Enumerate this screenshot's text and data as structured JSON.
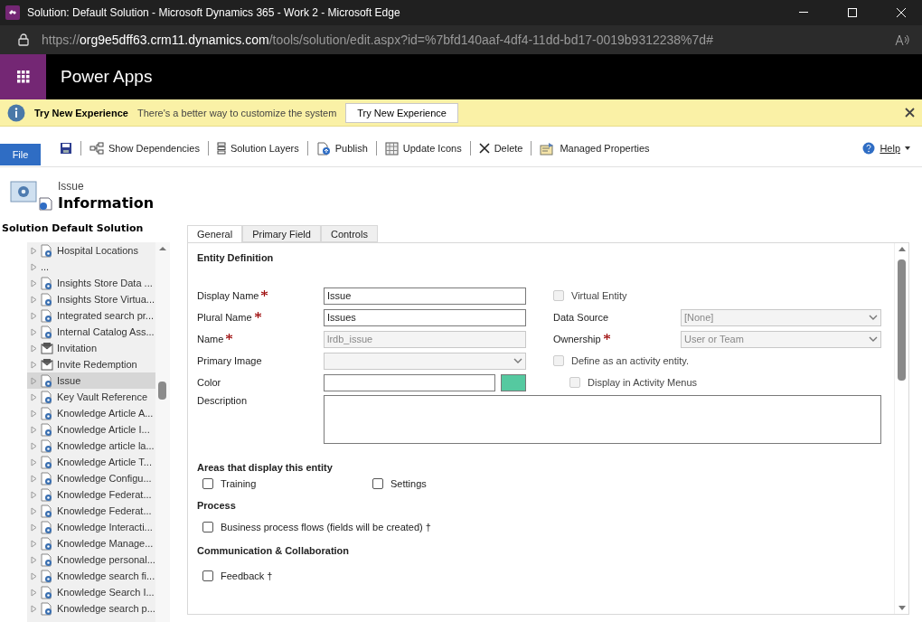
{
  "window": {
    "title": "Solution: Default Solution - Microsoft Dynamics 365 - Work 2 - Microsoft Edge",
    "url": {
      "scheme": "https://",
      "host": "org9e5dff63.crm11.dynamics.com",
      "path": "/tools/solution/edit.aspx?id=%7bfd140aaf-4df4-11dd-bd17-0019b9312238%7d#"
    }
  },
  "app_header": {
    "title": "Power Apps"
  },
  "notification": {
    "title": "Try New Experience",
    "message": "There's a better way to customize the system",
    "button": "Try New Experience"
  },
  "toolbar": {
    "file": "File",
    "items": [
      {
        "kind": "save"
      },
      {
        "kind": "deps",
        "label": "Show Dependencies"
      },
      {
        "kind": "layers",
        "label": "Solution Layers"
      },
      {
        "kind": "publish",
        "label": "Publish"
      },
      {
        "kind": "icons",
        "label": "Update Icons"
      },
      {
        "kind": "delete",
        "label": "Delete"
      },
      {
        "kind": "props",
        "label": "Managed Properties"
      }
    ],
    "help": "Help"
  },
  "entity_header": {
    "entity": "Issue",
    "section": "Information"
  },
  "sidebar": {
    "title": "Solution Default Solution",
    "items": [
      {
        "label": "Hospital Locations",
        "kind": "entity",
        "selected": false
      },
      {
        "label": "...",
        "kind": "blank",
        "selected": false
      },
      {
        "label": "Insights Store Data ...",
        "kind": "entity",
        "selected": false
      },
      {
        "label": "Insights Store Virtua...",
        "kind": "entity",
        "selected": false
      },
      {
        "label": "Integrated search pr...",
        "kind": "entity",
        "selected": false
      },
      {
        "label": "Internal Catalog Ass...",
        "kind": "entity",
        "selected": false
      },
      {
        "label": "Invitation",
        "kind": "mail",
        "selected": false
      },
      {
        "label": "Invite Redemption",
        "kind": "mail",
        "selected": false
      },
      {
        "label": "Issue",
        "kind": "entity",
        "selected": true
      },
      {
        "label": "Key Vault Reference",
        "kind": "entity",
        "selected": false
      },
      {
        "label": "Knowledge Article A...",
        "kind": "entity",
        "selected": false
      },
      {
        "label": "Knowledge Article I...",
        "kind": "entity",
        "selected": false
      },
      {
        "label": "Knowledge article la...",
        "kind": "entity",
        "selected": false
      },
      {
        "label": "Knowledge Article T...",
        "kind": "entity",
        "selected": false
      },
      {
        "label": "Knowledge Configu...",
        "kind": "entity",
        "selected": false
      },
      {
        "label": "Knowledge Federat...",
        "kind": "entity",
        "selected": false
      },
      {
        "label": "Knowledge Federat...",
        "kind": "entity",
        "selected": false
      },
      {
        "label": "Knowledge Interacti...",
        "kind": "entity",
        "selected": false
      },
      {
        "label": "Knowledge Manage...",
        "kind": "entity",
        "selected": false
      },
      {
        "label": "Knowledge personal...",
        "kind": "entity",
        "selected": false
      },
      {
        "label": "Knowledge search fi...",
        "kind": "entity",
        "selected": false
      },
      {
        "label": "Knowledge Search I...",
        "kind": "entity",
        "selected": false
      },
      {
        "label": "Knowledge search p...",
        "kind": "entity",
        "selected": false
      }
    ]
  },
  "tabs": [
    {
      "label": "General",
      "selected": true
    },
    {
      "label": "Primary Field",
      "selected": false
    },
    {
      "label": "Controls",
      "selected": false
    }
  ],
  "entity_definition": {
    "heading": "Entity Definition",
    "left_fields": [
      {
        "label": "Display Name",
        "required": true,
        "kind": "text",
        "value": "Issue",
        "disabled": false
      },
      {
        "label": "Plural Name",
        "required": true,
        "kind": "text",
        "value": "Issues",
        "disabled": false
      },
      {
        "label": "Name",
        "required": true,
        "kind": "text",
        "value": "lrdb_issue",
        "disabled": true
      },
      {
        "label": "Primary Image",
        "required": false,
        "kind": "select",
        "disabled": true
      },
      {
        "label": "Color",
        "required": false,
        "kind": "color",
        "color": "#55c9a0",
        "disabled": false
      }
    ],
    "description_label": "Description",
    "virtual_entity": {
      "label": "Virtual Entity",
      "checked": false,
      "disabled": true
    },
    "right_fields": [
      {
        "label": "Data Source",
        "required": false,
        "value": "[None]",
        "disabled": true
      },
      {
        "label": "Ownership",
        "required": true,
        "value": "User or Team",
        "disabled": true
      }
    ],
    "activity_entity": {
      "label": "Define as an activity entity.",
      "checked": false,
      "disabled": true
    },
    "activity_menus": {
      "label": "Display in Activity Menus",
      "checked": false,
      "disabled": true
    }
  },
  "areas": {
    "heading": "Areas that display this entity",
    "options": [
      {
        "label": "Training",
        "checked": false
      },
      {
        "label": "Settings",
        "checked": false
      }
    ]
  },
  "process": {
    "heading": "Process",
    "options": [
      {
        "label": "Business process flows (fields will be created) †",
        "checked": false
      }
    ]
  },
  "communication": {
    "heading": "Communication & Collaboration",
    "options": [
      {
        "label": "Feedback †",
        "checked": false
      }
    ]
  }
}
